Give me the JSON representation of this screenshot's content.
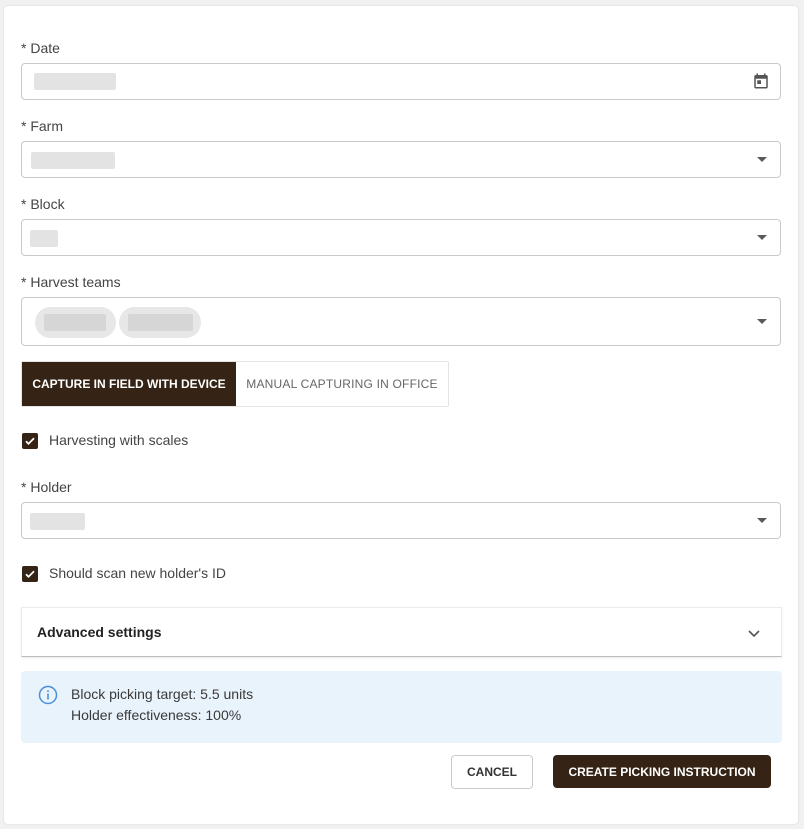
{
  "form": {
    "date": {
      "label": "* Date",
      "icon": "calendar-icon"
    },
    "farm": {
      "label": "* Farm"
    },
    "block": {
      "label": "* Block"
    },
    "harvest_teams": {
      "label": "* Harvest teams"
    },
    "capture_mode": {
      "options": [
        "CAPTURE IN FIELD WITH DEVICE",
        "MANUAL CAPTURING IN OFFICE"
      ],
      "selected": "CAPTURE IN FIELD WITH DEVICE"
    },
    "harvesting_with_scales": {
      "label": "Harvesting with scales",
      "checked": true
    },
    "holder": {
      "label": "* Holder"
    },
    "scan_holder_id": {
      "label": "Should scan new holder's ID",
      "checked": true
    },
    "advanced_settings": {
      "title": "Advanced settings",
      "icon": "chevron-down-icon"
    }
  },
  "info": {
    "icon": "info-icon",
    "lines": [
      "Block picking target: 5.5 units",
      "Holder effectiveness: 100%"
    ]
  },
  "actions": {
    "cancel_label": "CANCEL",
    "create_label": "CREATE PICKING INSTRUCTION"
  },
  "colors": {
    "brand": "#352415",
    "info_bg": "#e9f3fc",
    "info_icon": "#4a90d9"
  }
}
